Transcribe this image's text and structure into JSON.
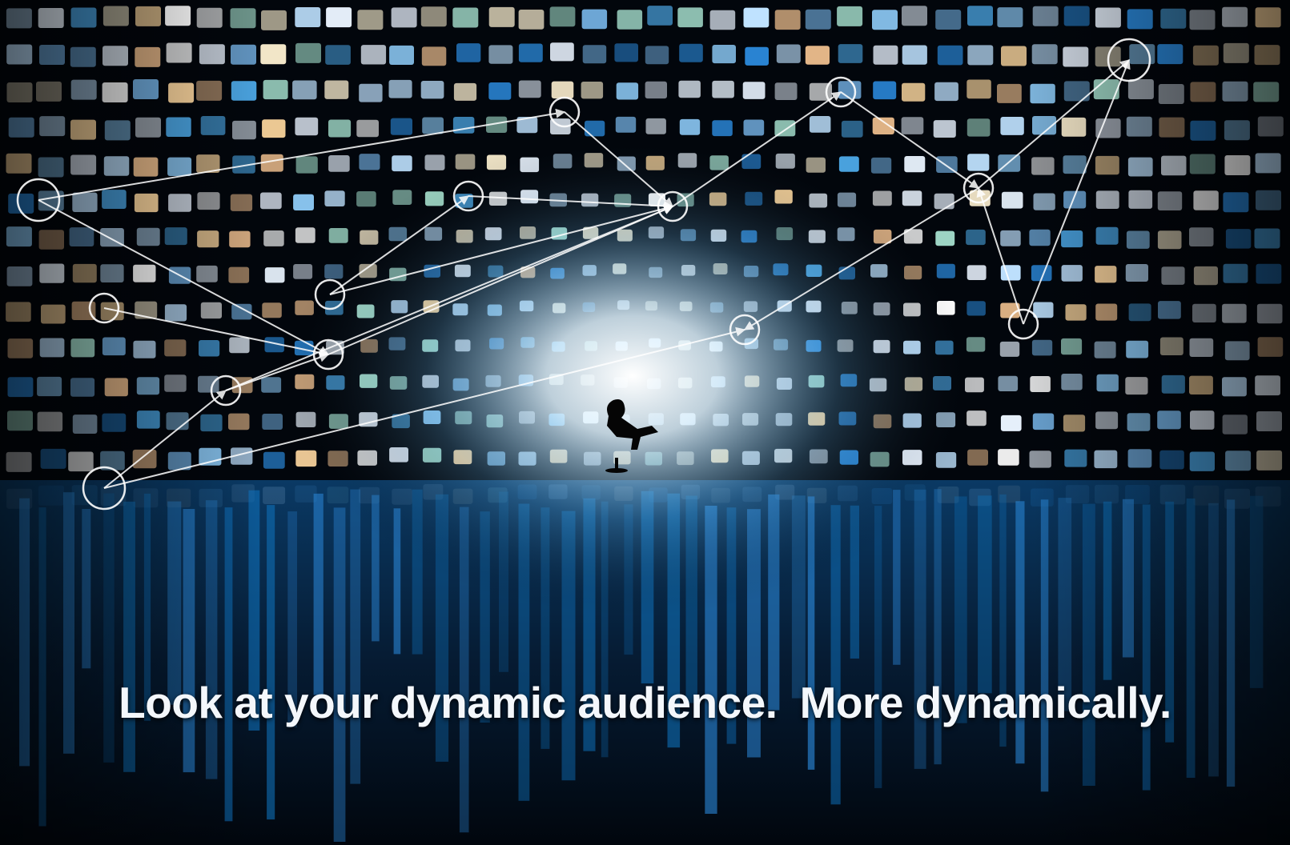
{
  "advert": {
    "headline_part1": "Look at your dynamic audience.",
    "headline_part2": "More dynamically."
  },
  "colors": {
    "background": "#02060c",
    "glow": "#e8f6ff",
    "screen_blue": "#2a86d6",
    "reflection_blue": "#0f6fb8",
    "connector": "#ffffff"
  },
  "scene_elements": [
    "video-screen-wall",
    "network-node-circles",
    "connector-arrows",
    "seated-viewer-silhouette",
    "floor-reflection"
  ]
}
